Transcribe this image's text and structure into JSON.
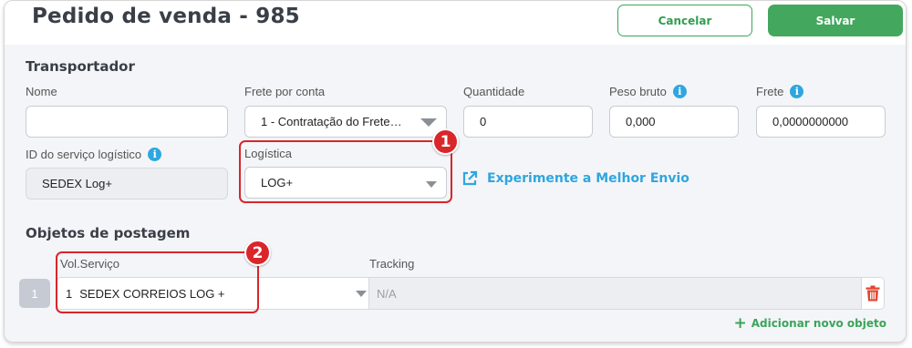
{
  "header": {
    "title": "Pedido de venda - 985",
    "cancel_label": "Cancelar",
    "save_label": "Salvar"
  },
  "transportador": {
    "section_title": "Transportador",
    "nome": {
      "label": "Nome",
      "value": ""
    },
    "frete_por_conta": {
      "label": "Frete por conta",
      "value": "1 - Contratação do Frete…"
    },
    "quantidade": {
      "label": "Quantidade",
      "value": "0"
    },
    "peso_bruto": {
      "label": "Peso bruto",
      "value": "0,000"
    },
    "frete": {
      "label": "Frete",
      "value": "0,0000000000"
    },
    "id_servico": {
      "label": "ID do serviço logístico",
      "value": "SEDEX Log+"
    },
    "logistica": {
      "label": "Logística",
      "value": "LOG+"
    },
    "melhor_envio_link": "Experimente a Melhor Envio"
  },
  "objetos": {
    "section_title": "Objetos de postagem",
    "col_vol_servico": "Vol.Serviço",
    "col_tracking": "Tracking",
    "rows": [
      {
        "index": "1",
        "vol": "1",
        "servico": "SEDEX CORREIOS LOG +",
        "tracking": "N/A"
      }
    ],
    "add_label": "Adicionar novo objeto"
  },
  "annotations": {
    "badge_1": "1",
    "badge_2": "2"
  },
  "colors": {
    "accent_green": "#43a85d",
    "accent_blue": "#2fa6df",
    "highlight_red": "#d9262b",
    "trash_red": "#e0442f"
  },
  "icons": [
    "info-icon",
    "external-link-icon",
    "chevron-down-icon",
    "trash-icon",
    "plus-icon"
  ]
}
